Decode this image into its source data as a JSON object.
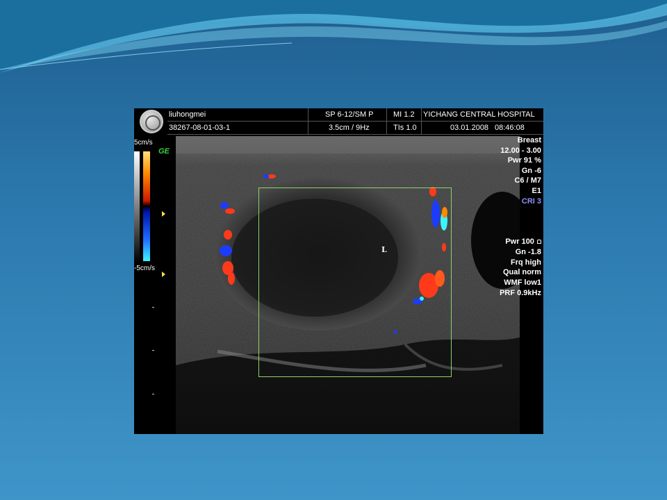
{
  "header": {
    "patient_name": "liuhongmei",
    "patient_id": "38267-08-01-03-1",
    "probe": "SP 6-12/SM P",
    "depth_rate": "3.5cm / 9Hz",
    "mi": "MI  1.2",
    "tis": "TIs  1.0",
    "hospital": "YICHANG CENTRAL HOSPITAL",
    "date": "03.01.2008",
    "time": "08:46:08"
  },
  "scale": {
    "top_label": "5cm/s",
    "bottom_label": "-5cm/s",
    "logo_text": "GE"
  },
  "params_top": [
    "Breast",
    "12.00 - 3.00",
    "Pwr  91 %",
    "Gn  -6",
    "C6 / M7",
    "E1",
    "CRI 3"
  ],
  "params_bottom": [
    "Pwr 100",
    "Gn -1.8",
    "Frq high",
    "Qual norm",
    "WMF low1",
    "PRF  0.9kHz"
  ],
  "image_marker": "L",
  "colors": {
    "cri_text": "#8f8fff",
    "roi_box": "#8fd46a",
    "flow_red": "#ff3a1a",
    "flow_blue": "#1b3cff",
    "ge_green": "#3ad13a"
  }
}
